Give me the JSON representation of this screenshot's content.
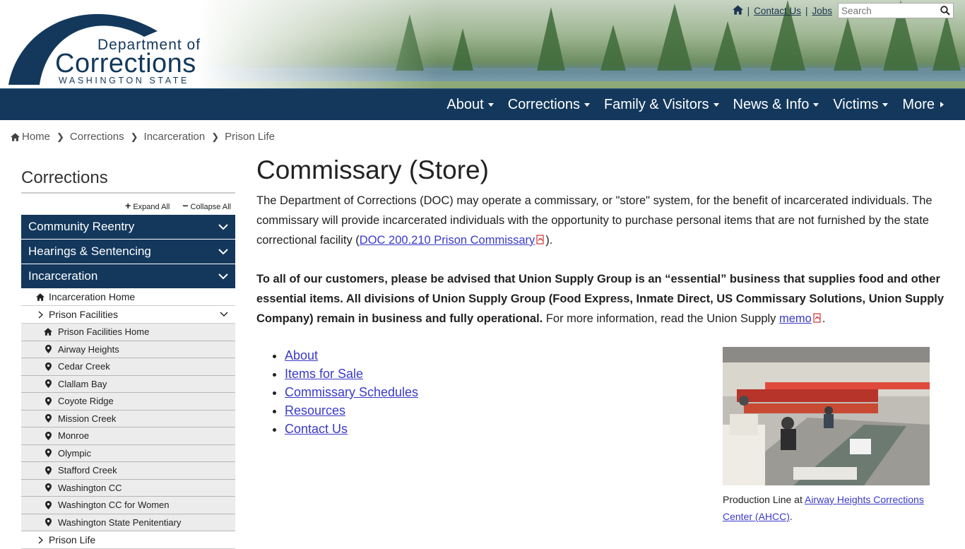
{
  "header": {
    "logo": {
      "line1": "Department of",
      "line2": "Corrections",
      "line3": "WASHINGTON STATE"
    },
    "utility": {
      "contact_label": "Contact Us",
      "jobs_label": "Jobs",
      "search_placeholder": "Search"
    }
  },
  "nav": {
    "items": [
      {
        "label": "About"
      },
      {
        "label": "Corrections"
      },
      {
        "label": "Family & Visitors"
      },
      {
        "label": "News & Info"
      },
      {
        "label": "Victims"
      },
      {
        "label": "More"
      }
    ]
  },
  "breadcrumb": [
    "Home",
    "Corrections",
    "Incarceration",
    "Prison Life"
  ],
  "sidebar": {
    "title": "Corrections",
    "expand_all": "Expand All",
    "collapse_all": "Collapse All",
    "sections": [
      "Community Reentry",
      "Hearings & Sentencing",
      "Incarceration"
    ],
    "incarceration_home": "Incarceration Home",
    "prison_facilities": "Prison Facilities",
    "facilities": [
      "Prison Facilities Home",
      "Airway Heights",
      "Cedar Creek",
      "Clallam Bay",
      "Coyote Ridge",
      "Mission Creek",
      "Monroe",
      "Olympic",
      "Stafford Creek",
      "Washington CC",
      "Washington CC for Women",
      "Washington State Penitentiary"
    ],
    "prison_life": "Prison Life"
  },
  "content": {
    "title": "Commissary (Store)",
    "intro": "The Department of Corrections (DOC) may operate a commissary, or \"store\" system, for the benefit of incarcerated individuals. The commissary will provide incarcerated individuals with the opportunity to purchase personal items that are not furnished by the state correctional facility (",
    "intro_link": "DOC 200.210 Prison Commissary",
    "intro_end": ").",
    "notice_bold": "To all of our customers, please be advised that Union Supply Group is an “essential” business that supplies food and other essential items. All divisions of Union Supply Group (Food Express, Inmate Direct, US Commissary Solutions, Union Supply Company) remain in business and fully operational.",
    "notice_rest": " For more information, read the Union Supply ",
    "notice_link": "memo",
    "notice_end": ".",
    "links": [
      "About",
      "Items for Sale",
      "Commissary Schedules",
      "Resources",
      "Contact Us"
    ],
    "caption_prefix": "Production Line at ",
    "caption_link": "Airway Heights Corrections Center (AHCC)",
    "caption_end": "."
  },
  "colors": {
    "navy": "#13385c",
    "link": "#3a3ac8",
    "submenu_bg": "#ececec"
  }
}
